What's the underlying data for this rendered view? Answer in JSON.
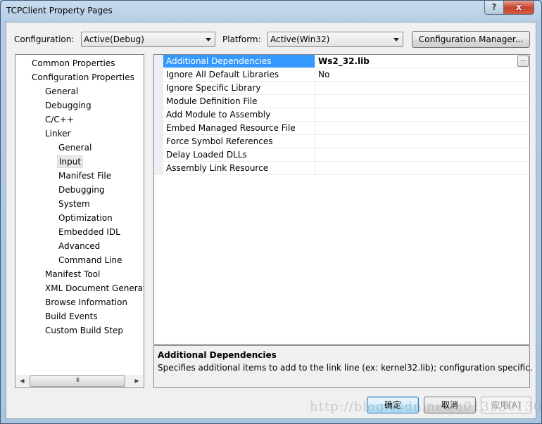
{
  "window": {
    "title": "TCPClient Property Pages",
    "help_label": "?",
    "close_label": "x"
  },
  "toolbar": {
    "configuration_label": "Configuration:",
    "configuration_value": "Active(Debug)",
    "platform_label": "Platform:",
    "platform_value": "Active(Win32)",
    "config_manager_label": "Configuration Manager..."
  },
  "tree": {
    "items": [
      {
        "label": "Common Properties",
        "level": 0
      },
      {
        "label": "Configuration Properties",
        "level": 0
      },
      {
        "label": "General",
        "level": 1
      },
      {
        "label": "Debugging",
        "level": 1
      },
      {
        "label": "C/C++",
        "level": 1
      },
      {
        "label": "Linker",
        "level": 1
      },
      {
        "label": "General",
        "level": 2
      },
      {
        "label": "Input",
        "level": 2,
        "selected": true
      },
      {
        "label": "Manifest File",
        "level": 2
      },
      {
        "label": "Debugging",
        "level": 2
      },
      {
        "label": "System",
        "level": 2
      },
      {
        "label": "Optimization",
        "level": 2
      },
      {
        "label": "Embedded IDL",
        "level": 2
      },
      {
        "label": "Advanced",
        "level": 2
      },
      {
        "label": "Command Line",
        "level": 2
      },
      {
        "label": "Manifest Tool",
        "level": 1
      },
      {
        "label": "XML Document Generat",
        "level": 1
      },
      {
        "label": "Browse Information",
        "level": 1
      },
      {
        "label": "Build Events",
        "level": 1
      },
      {
        "label": "Custom Build Step",
        "level": 1
      }
    ],
    "scroll_thumb_glyph": "III"
  },
  "grid": {
    "rows": [
      {
        "name": "Additional Dependencies",
        "value": "Ws2_32.lib",
        "selected": true,
        "bold": true,
        "has_ellipsis": true
      },
      {
        "name": "Ignore All Default Libraries",
        "value": "No"
      },
      {
        "name": "Ignore Specific Library",
        "value": ""
      },
      {
        "name": "Module Definition File",
        "value": ""
      },
      {
        "name": "Add Module to Assembly",
        "value": ""
      },
      {
        "name": "Embed Managed Resource File",
        "value": ""
      },
      {
        "name": "Force Symbol References",
        "value": ""
      },
      {
        "name": "Delay Loaded DLLs",
        "value": ""
      },
      {
        "name": "Assembly Link Resource",
        "value": ""
      }
    ],
    "ellipsis_label": "..."
  },
  "description": {
    "title": "Additional Dependencies",
    "text": "Specifies additional items to add to the link line (ex: kernel32.lib); configuration specific."
  },
  "buttons": {
    "ok_label": "确定",
    "cancel_label": "取消",
    "apply_label": "应用(A)"
  },
  "watermark": "http://blog.csdn.net/u013530130",
  "colors": {
    "selection": "#3399ff",
    "close_button": "#c7452f"
  }
}
